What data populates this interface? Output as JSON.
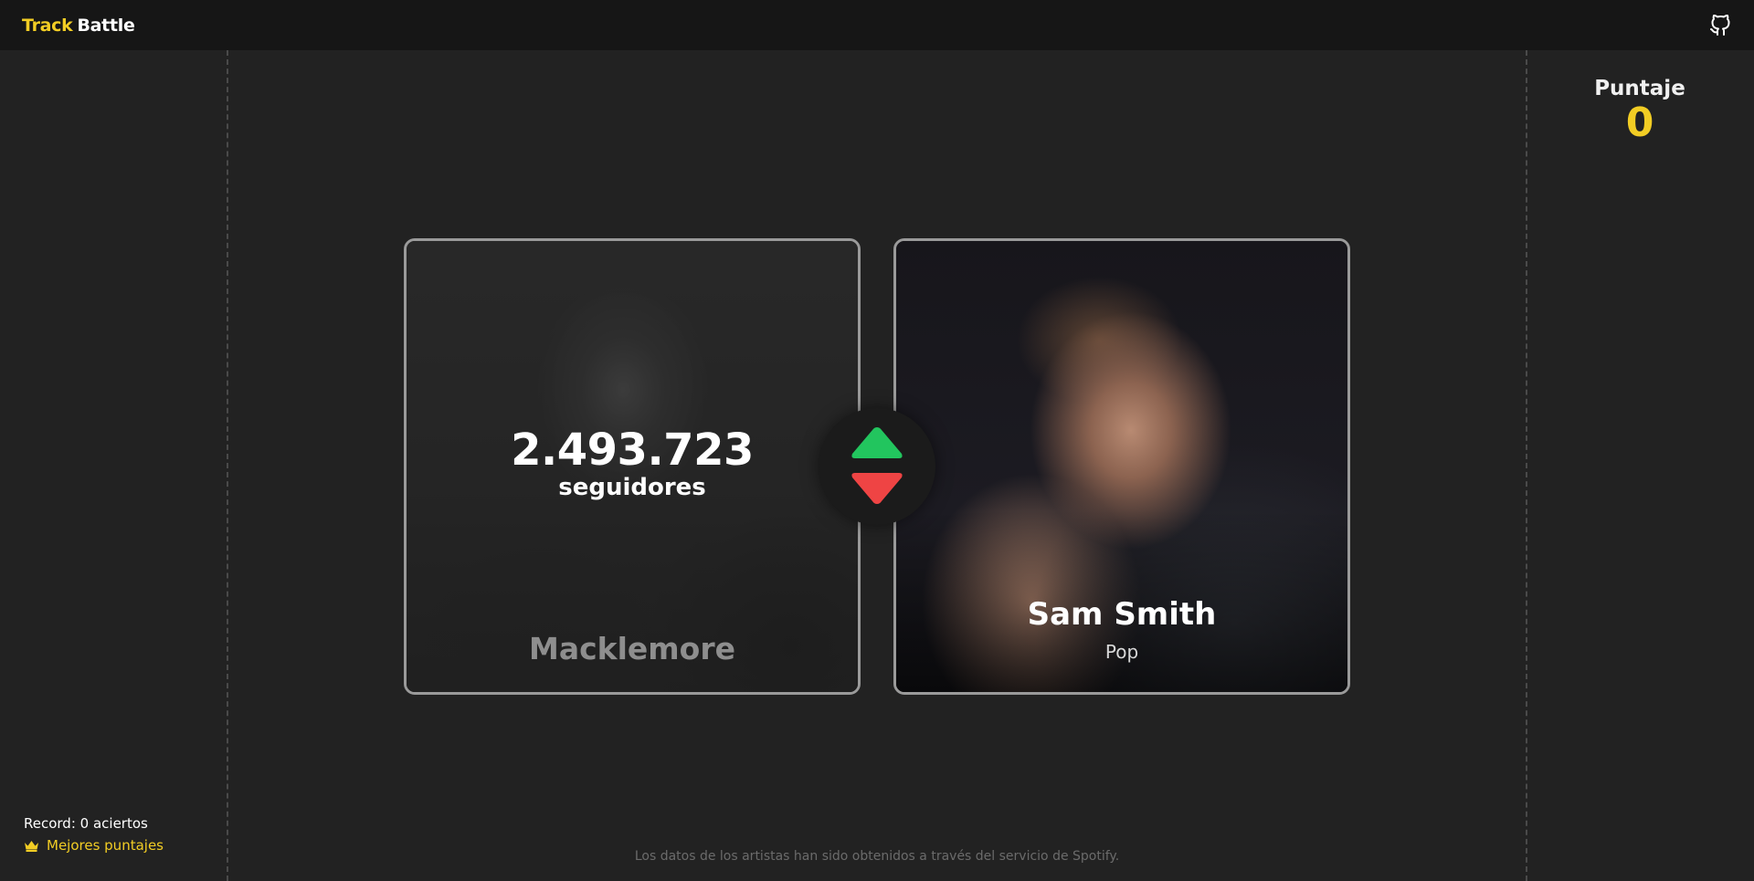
{
  "header": {
    "brand_part1": "Track",
    "brand_part2": "Battle",
    "github_icon": "github-icon"
  },
  "score": {
    "label": "Puntaje",
    "value": "0"
  },
  "left_card": {
    "followers": "2.493.723",
    "followers_label": "seguidores",
    "artist": "Macklemore"
  },
  "right_card": {
    "artist": "Sam Smith",
    "genre": "Pop"
  },
  "controls": {
    "higher_icon": "triangle-up-icon",
    "lower_icon": "triangle-down-icon",
    "higher_color": "#22c55e",
    "lower_color": "#ef4444"
  },
  "record": {
    "text": "Record: 0 aciertos",
    "best_label": "Mejores puntajes",
    "best_icon": "crown-icon"
  },
  "footer": {
    "text": "Los datos de los artistas han sido obtenidos a través del servicio de Spotify."
  },
  "colors": {
    "accent": "#f2cd24",
    "background": "#222222",
    "topbar": "#161616"
  }
}
